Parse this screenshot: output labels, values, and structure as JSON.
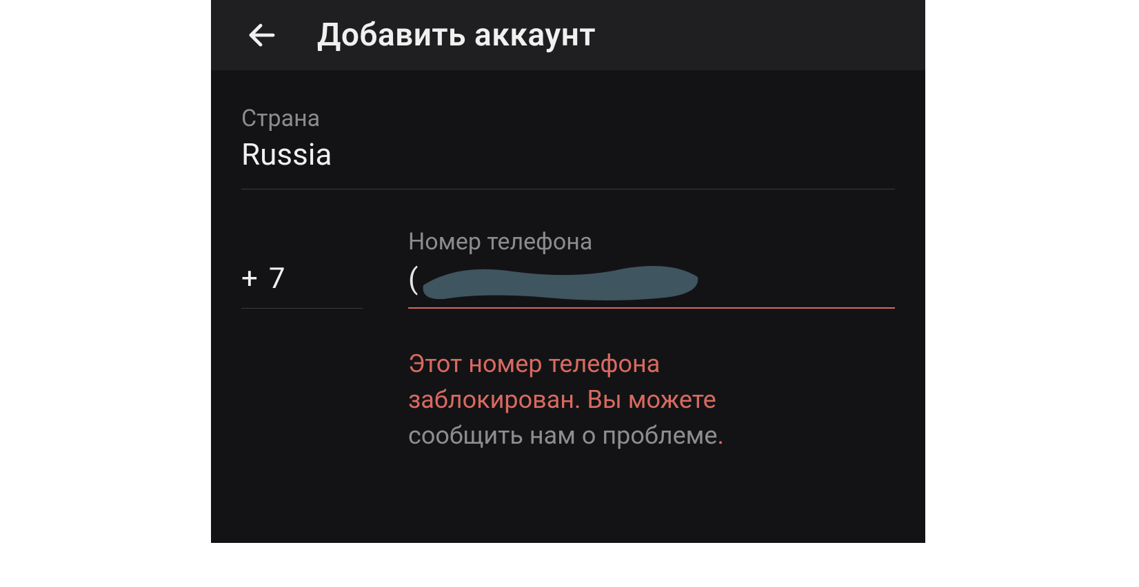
{
  "appbar": {
    "title": "Добавить аккаунт"
  },
  "form": {
    "country_label": "Страна",
    "country_value": "Russia",
    "phone_label": "Номер телефона",
    "plus": "+",
    "code_value": "7",
    "paren": "(",
    "number_value": ""
  },
  "error": {
    "line1": "Этот номер телефона",
    "line2_a": "заблокирован. ",
    "line2_b": "Вы можете",
    "link": "сообщить нам о проблеме",
    "dot": "."
  }
}
